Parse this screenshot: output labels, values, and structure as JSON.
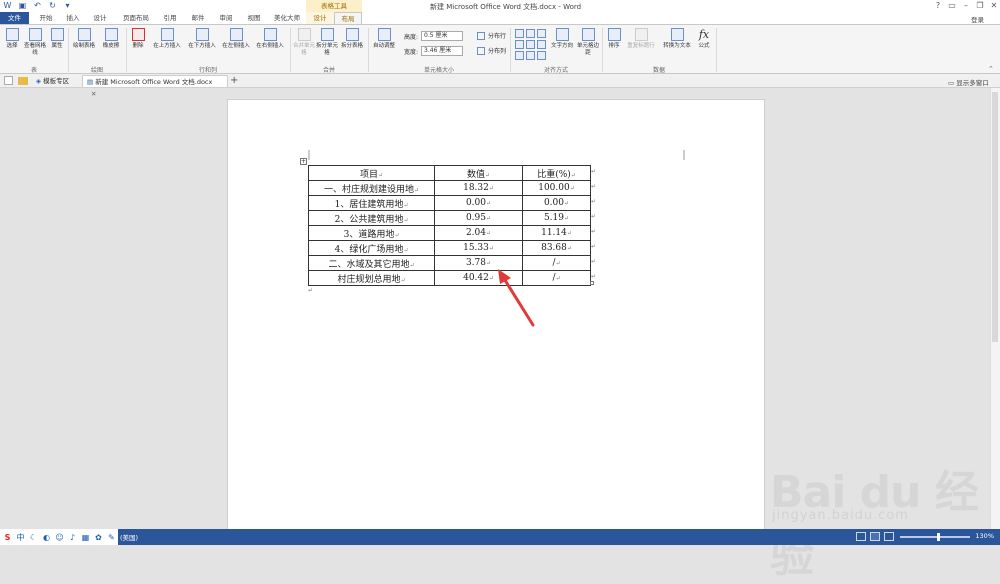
{
  "window": {
    "title": "新建 Microsoft Office Word 文档.docx - Word",
    "context_tool_label": "表格工具",
    "login": "登录"
  },
  "tabs": [
    {
      "label": "文件"
    },
    {
      "label": "开始"
    },
    {
      "label": "插入"
    },
    {
      "label": "设计"
    },
    {
      "label": "页面布局"
    },
    {
      "label": "引用"
    },
    {
      "label": "邮件"
    },
    {
      "label": "审阅"
    },
    {
      "label": "视图"
    },
    {
      "label": "美化大师"
    },
    {
      "label": "设计"
    },
    {
      "label": "布局"
    }
  ],
  "ribbon": {
    "buttons": {
      "select": "选择",
      "gridlines": "查看网格线",
      "properties": "属性",
      "draw_table": "绘制表格",
      "eraser": "橡皮擦",
      "delete": "删除",
      "insert_above": "在上方插入",
      "insert_below": "在下方插入",
      "insert_left": "在左侧插入",
      "insert_right": "在右侧插入",
      "merge_cells": "合并单元格",
      "split_cells": "拆分单元格",
      "split_table": "拆分表格",
      "autofit": "自动调整",
      "text_direction": "文字方向",
      "cell_margins": "单元格边距",
      "sort": "排序",
      "repeat_header": "重复标题行",
      "convert_to_text": "转换为文本",
      "formula": "公式"
    },
    "height_label": "高度:",
    "height_value": "0.5 厘米",
    "width_label": "宽度:",
    "width_value": "3.46 厘米",
    "distribute_rows": "分布行",
    "distribute_cols": "分布列",
    "groups": {
      "table": "表",
      "draw": "绘图",
      "rows_cols": "行和列",
      "merge": "合并",
      "cell_size": "单元格大小",
      "alignment": "对齐方式",
      "data": "数据"
    }
  },
  "doc_tabs": [
    {
      "label": "模板专区"
    },
    {
      "label": "新建 Microsoft Office Word 文档.docx"
    }
  ],
  "show_multi_window": "显示多窗口",
  "document": {
    "table": [
      [
        "项目",
        "数值",
        "比重(%)"
      ],
      [
        "一、村庄规划建设用地",
        "18.32",
        "100.00"
      ],
      [
        "1、居住建筑用地",
        "0.00",
        "0.00"
      ],
      [
        "2、公共建筑用地",
        "0.95",
        "5.19"
      ],
      [
        "3、道路用地",
        "2.04",
        "11.14"
      ],
      [
        "4、绿化广场用地",
        "15.33",
        "83.68"
      ],
      [
        "二、水域及其它用地",
        "3.78",
        "/"
      ],
      [
        "村庄规划总用地",
        "40.42",
        "/"
      ]
    ],
    "cell_mark": "↵"
  },
  "status": {
    "language": "(美国)",
    "zoom": "130%"
  },
  "watermark": {
    "brand": "Bai du 经验",
    "url": "jingyan.baidu.com"
  },
  "colors": {
    "word_blue": "#2b579a",
    "arrow_red": "#e23a3a",
    "context_gold": "#9b6a00"
  }
}
